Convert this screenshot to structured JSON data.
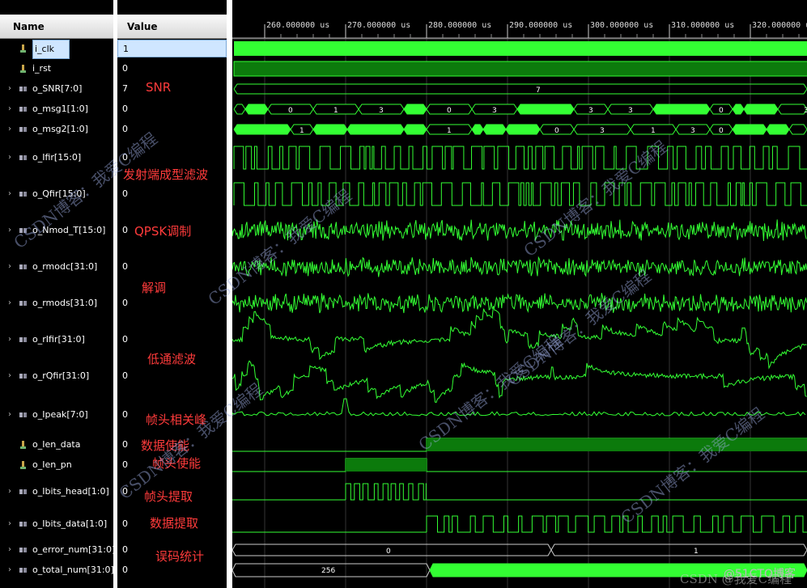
{
  "header": {
    "name_label": "Name",
    "value_label": "Value"
  },
  "timeline": {
    "ticks": [
      "260.000000 us",
      "270.000000 us",
      "280.000000 us",
      "290.000000 us",
      "300.000000 us",
      "310.000000 us",
      "320.000000 us"
    ]
  },
  "signals": [
    {
      "name": "i_clk",
      "value": "1",
      "kind": "bit",
      "expandable": false,
      "selected": true
    },
    {
      "name": "i_rst",
      "value": "0",
      "kind": "bit",
      "expandable": false
    },
    {
      "name": "o_SNR[7:0]",
      "value": "7",
      "kind": "bus",
      "expandable": true
    },
    {
      "name": "o_msg1[1:0]",
      "value": "0",
      "kind": "bus",
      "expandable": true
    },
    {
      "name": "o_msg2[1:0]",
      "value": "0",
      "kind": "bus",
      "expandable": true
    },
    {
      "name": "o_Ifir[15:0]",
      "value": "0",
      "kind": "bus",
      "expandable": true
    },
    {
      "name": "o_Qfir[15:0]",
      "value": "0",
      "kind": "bus",
      "expandable": true
    },
    {
      "name": "o_Nmod_T[15:0]",
      "value": "0",
      "kind": "bus",
      "expandable": true
    },
    {
      "name": "o_rmodc[31:0]",
      "value": "0",
      "kind": "bus",
      "expandable": true
    },
    {
      "name": "o_rmods[31:0]",
      "value": "0",
      "kind": "bus",
      "expandable": true
    },
    {
      "name": "o_rIfir[31:0]",
      "value": "0",
      "kind": "bus",
      "expandable": true
    },
    {
      "name": "o_rQfir[31:0]",
      "value": "0",
      "kind": "bus",
      "expandable": true
    },
    {
      "name": "o_Ipeak[7:0]",
      "value": "0",
      "kind": "bus",
      "expandable": true
    },
    {
      "name": "o_Ien_data",
      "value": "0",
      "kind": "bit",
      "expandable": false
    },
    {
      "name": "o_Ien_pn",
      "value": "0",
      "kind": "bit",
      "expandable": false
    },
    {
      "name": "o_Ibits_head[1:0]",
      "value": "0",
      "kind": "bus",
      "expandable": true
    },
    {
      "name": "o_Ibits_data[1:0]",
      "value": "0",
      "kind": "bus",
      "expandable": true
    },
    {
      "name": "o_error_num[31:0]",
      "value": "0",
      "kind": "bus",
      "expandable": true
    },
    {
      "name": "o_total_num[31:0]",
      "value": "0",
      "kind": "bus",
      "expandable": true
    }
  ],
  "annotations": [
    "SNR",
    "发射端成型滤波",
    "QPSK调制",
    "解调",
    "低通滤波",
    "帧头相关峰",
    "数据使能",
    "帧头使能",
    "帧头提取",
    "数据提取",
    "误码统计"
  ],
  "bus_labels": {
    "snr": "7",
    "error_num_a": "0",
    "error_num_b": "1",
    "total_num_a": "256",
    "msg_digits": [
      "0",
      "1",
      "3"
    ]
  },
  "watermark": {
    "text1": "CSDN博客：我爱C编程",
    "footer": "CSDN @我爱C编程",
    "corner": "@51CTO博客"
  },
  "colors": {
    "wave": "#33ff33",
    "wave_dark": "#0c7a0c",
    "bg": "#000000",
    "annotation": "#ff3b3b"
  }
}
